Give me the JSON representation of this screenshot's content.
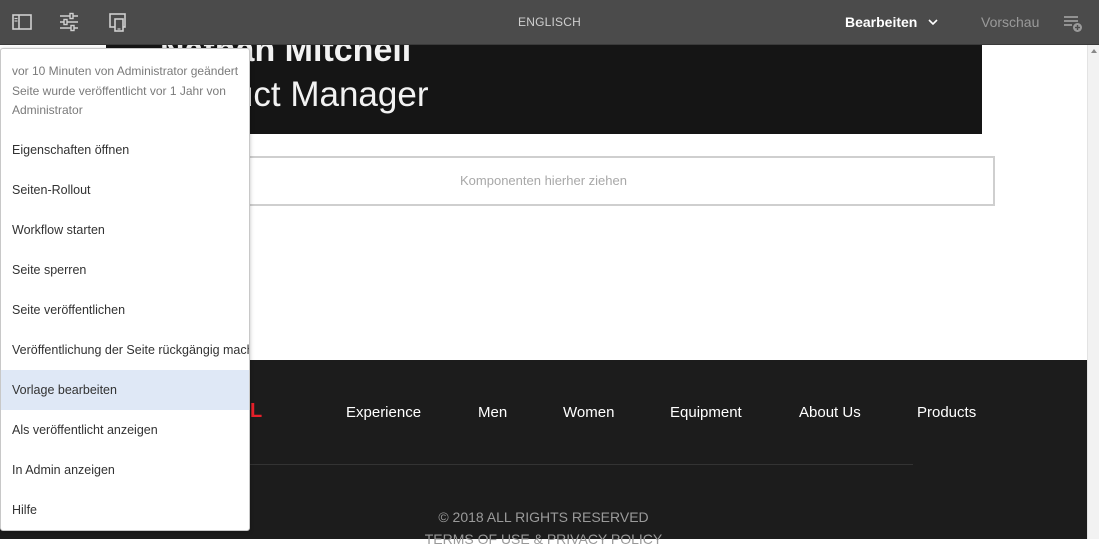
{
  "toolbar": {
    "language": "ENGLISCH",
    "mode_label": "Bearbeiten",
    "preview_label": "Vorschau",
    "icons": [
      "side-panel-icon",
      "page-properties-icon",
      "emulator-icon",
      "chevron-down-icon",
      "annotations-icon"
    ]
  },
  "hero": {
    "name": "Nathan Mitchell",
    "title": "Product Manager"
  },
  "dropzone": {
    "placeholder": "Komponenten hierher ziehen"
  },
  "footer": {
    "logo": "L",
    "nav": [
      "Experience",
      "Men",
      "Women",
      "Equipment",
      "About Us",
      "Products"
    ],
    "copyright": "© 2018 ALL RIGHTS RESERVED",
    "terms": "TERMS OF USE & PRIVACY POLICY"
  },
  "page_info_menu": {
    "info_line_1": "vor 10 Minuten von Administrator geändert",
    "info_line_2": "Seite wurde veröffentlicht vor 1 Jahr von Administrator",
    "items": [
      "Eigenschaften öffnen",
      "Seiten-Rollout",
      "Workflow starten",
      "Seite sperren",
      "Seite veröffentlichen",
      "Veröffentlichung der Seite rückgängig machen",
      "Vorlage bearbeiten",
      "Als veröffentlicht anzeigen",
      "In Admin anzeigen",
      "Hilfe"
    ],
    "highlighted_item": "Vorlage bearbeiten"
  },
  "colors": {
    "toolbar_bg": "#4b4b4b",
    "menu_highlight": "#dfe8f6",
    "footer_bg": "#1c1c1c",
    "logo_accent": "#e8202a"
  }
}
